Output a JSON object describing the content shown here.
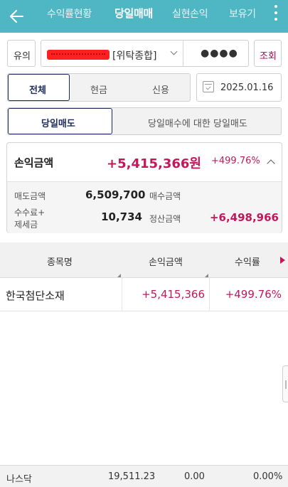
{
  "nav": {
    "tabs": [
      {
        "label": "수익률현황",
        "active": false
      },
      {
        "label": "당일매매",
        "active": true
      },
      {
        "label": "실현손익",
        "active": false
      },
      {
        "label": "보유기",
        "active": false
      }
    ],
    "icons": {
      "back": "back-arrow-icon",
      "more": "more-vertical-icon"
    }
  },
  "account": {
    "prefix_label": "유의",
    "account_type": "[위탁종합]",
    "password_mask": "●●●●",
    "query_label": "조회"
  },
  "filter": {
    "options": [
      "전체",
      "현금",
      "신용"
    ],
    "selected": "전체",
    "date": "2025.01.16"
  },
  "mode": {
    "options": [
      "당일매도",
      "당일매수에 대한 당일매도"
    ],
    "selected": "당일매도"
  },
  "summary": {
    "pl_label": "손익금액",
    "pl_value": "+5,415,366원",
    "pl_rate": "+499.76%",
    "sell_label": "매도금액",
    "sell_value": "6,509,700",
    "buy_label": "매수금액",
    "buy_value": "",
    "fee_label_line1": "수수료+",
    "fee_label_line2": "제세금",
    "fee_value": "10,734",
    "settle_label": "정산금액",
    "settle_value": "+6,498,966"
  },
  "table": {
    "headers": [
      "종목명",
      "손익금액",
      "수익률"
    ],
    "rows": [
      {
        "name": "한국첨단소재",
        "pl": "+5,415,366",
        "rate": "+499.76%"
      }
    ]
  },
  "ticker": {
    "name": "나스닥",
    "value": "19,511.23",
    "change": "0.00",
    "rate": "0.00%"
  },
  "colors": {
    "header_bg": "#4fb7c3",
    "accent_navy": "#1e2a5a",
    "profit_pink": "#c2185b"
  }
}
